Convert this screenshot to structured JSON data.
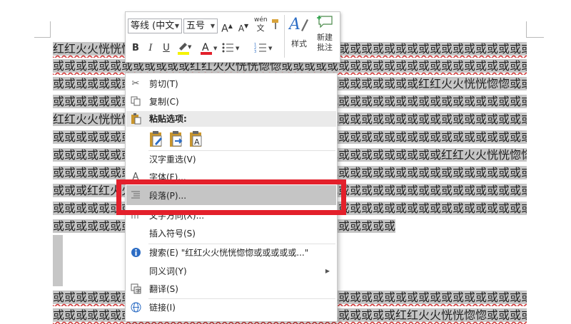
{
  "document": {
    "lines": [
      "红红火火恍恍惚惚或或或或或或或或或或或或或或或或或或或或或或或或或或或或或或或或或或或或或或或或",
      "或或或或或或或或或或或或红红火火恍恍惚惚或或或或或或或或或或或或或或或或或或或或或或或或或或或或",
      "或或或或或或或或或或或或或或或或或或或或或或或或或或或或或或或或红红火火恍恍惚惚或或或或或或或或",
      "或或或或或或或或或或或或或或或或或或或或或或或或或或或或或或或或或或或或或或或或或或或或或或或或",
      "红红火火恍恍惚惚或或或或或或或或或或或或或或或或或或或或或或或或或或或或或或或或或或或或或或或或",
      "或或或或或或或或或或或或或或或或或或或或或或或或或或或或或或或或或或或或或或或或或或或或或或或或",
      "或或或或或或或或或或或或或或或或或或或或或或或或或或或或或或或或或或红红火火恍恍惚惚或或或或或或",
      "或或或或或或或或或或或或或或或或或或或或或或或或或或或或或或或或或或或或或或或或或或或或或或或或",
      "或或或红红火火恍恍惚惚或或或或或或或或或或或或或或或或或或或或或或或或或或或或或或或或或或或或或或",
      "或或或或或或或或或或或或或或或或或或或或或或或或或或或或或或或或或或或或或或或或或或或或或或或或",
      "或或或或或或或或或或或或或或或或或或或或或或或或或或或或或或或或或或或或或或或或或或或或或或或或"
    ],
    "lines_bottom": [
      "或或或或或或或或或或或或或或或或或或或或或或或或或或或或或或或或或或或或或或或或或或或或或或或或",
      "或或或或或或或或或或或或或或或或或或或或或或或或或或或或或或红红火火恍恍惚惚或或或或或或或或或或"
    ],
    "paragraph_mark": "↵"
  },
  "mini_toolbar": {
    "font_name": "等线 (中文",
    "font_size": "五号",
    "grow_font": "A",
    "shrink_font": "A",
    "phonetic_top": "wén",
    "phonetic_bottom": "文",
    "bold": "B",
    "italic": "I",
    "underline": "U",
    "font_color_glyph": "A",
    "styles_label": "样式",
    "new_comment_line1": "新建",
    "new_comment_line2": "批注",
    "colors": {
      "highlight": "#f5f300",
      "font_color": "#e3202b",
      "styles_accent": "#2b6cc4"
    }
  },
  "context_menu": {
    "cut": "剪切(T)",
    "copy": "复制(C)",
    "paste_options": "粘贴选项:",
    "hanzi_reselect": "汉字重选(V)",
    "font": "字体(F)...",
    "paragraph": "段落(P)...",
    "text_direction": "文字方向(X)...",
    "insert_symbol": "插入符号(S)",
    "search": "搜索(E) \"红红火火恍恍惚惚或或或或或...\"",
    "synonyms": "同义词(Y)",
    "translate": "翻译(S)",
    "link": "链接(I)",
    "submenu_arrow": "▶"
  },
  "highlight_color": "#e3202b"
}
